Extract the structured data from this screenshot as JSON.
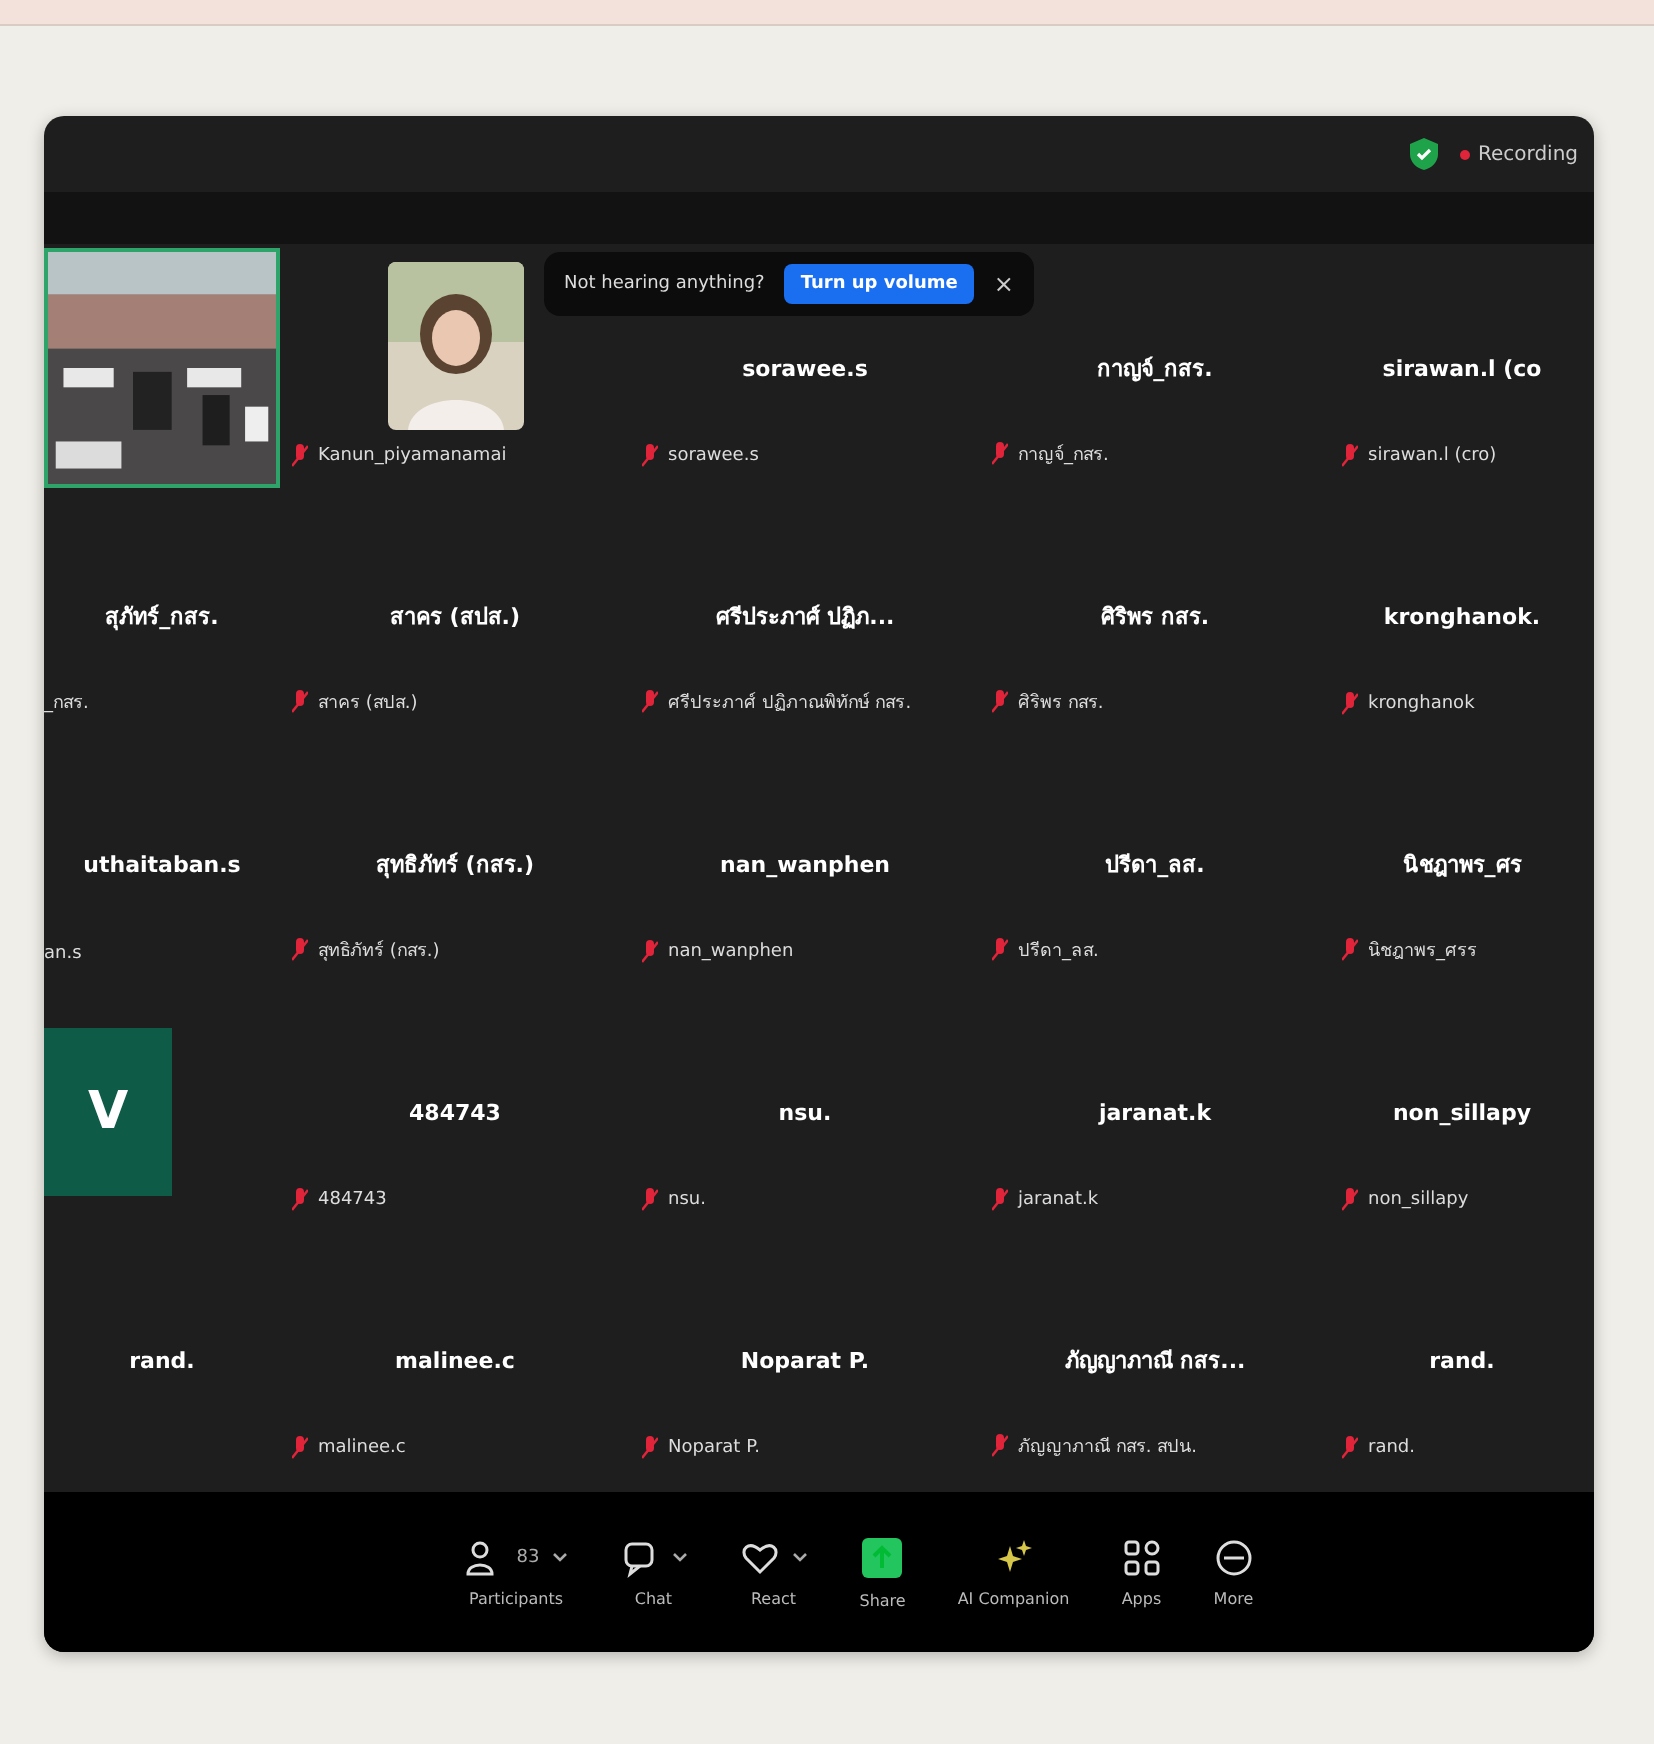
{
  "top_bar": {
    "recording": "Recording"
  },
  "toast": {
    "message": "Not hearing anything?",
    "button": "Turn up volume",
    "close": "×"
  },
  "tiles": [
    {
      "kind": "video"
    },
    {
      "label": "Kanun_piyamanamai",
      "muted": true
    },
    {
      "kind": "name",
      "name": "sorawee.s",
      "label": "sorawee.s",
      "muted": true
    },
    {
      "kind": "name",
      "name": "กาญจ์_กสร.",
      "label": "กาญจ์_กสร.",
      "muted": true
    },
    {
      "kind": "name",
      "name": "sirawan.l (co",
      "label": "sirawan.l (cro)",
      "muted": true
    },
    {
      "kind": "name",
      "name": "สุภัทร์_กสร.",
      "label": "_กสร."
    },
    {
      "kind": "name",
      "name": "สาคร (สปส.)",
      "label": "สาคร (สปส.)",
      "muted": true
    },
    {
      "kind": "name",
      "name": "ศรีประภาศ์ ปฏิภ...",
      "label": "ศรีประภาศ์ ปฏิภาณพิทักษ์ กสร.",
      "muted": true
    },
    {
      "kind": "name",
      "name": "ศิริพร กสร.",
      "label": "ศิริพร กสร.",
      "muted": true
    },
    {
      "kind": "name",
      "name": "kronghanok.",
      "label": "kronghanok",
      "muted": true
    },
    {
      "kind": "name",
      "name": "uthaitaban.s",
      "label": "an.s"
    },
    {
      "kind": "name",
      "name": "สุทธิภัทร์ (กสร.)",
      "label": "สุทธิภัทร์ (กสร.)",
      "muted": true
    },
    {
      "kind": "name",
      "name": "nan_wanphen",
      "label": "nan_wanphen",
      "muted": true
    },
    {
      "kind": "name",
      "name": "ปรีดา_ลส.",
      "label": "ปรีดา_ลส.",
      "muted": true
    },
    {
      "kind": "name",
      "name": "นิชฎาพร_ศร",
      "label": "นิชฎาพร_ศรร",
      "muted": true
    },
    {
      "kind": "avatar",
      "name": "V"
    },
    {
      "kind": "name",
      "name": "484743",
      "label": "484743",
      "muted": true
    },
    {
      "kind": "name",
      "name": "nsu.",
      "label": "nsu.",
      "muted": true
    },
    {
      "kind": "name",
      "name": "jaranat.k",
      "label": "jaranat.k",
      "muted": true
    },
    {
      "kind": "name",
      "name": "non_sillapy",
      "label": "non_sillapy",
      "muted": true
    },
    {
      "kind": "name",
      "name": "rand."
    },
    {
      "kind": "name",
      "name": "malinee.c",
      "label": "malinee.c",
      "muted": true
    },
    {
      "kind": "name",
      "name": "Noparat P.",
      "label": "Noparat P.",
      "muted": true
    },
    {
      "kind": "name",
      "name": "ภัญญาภาณี กสร...",
      "label": "ภัญญาภาณี กสร. สปน.",
      "muted": true
    },
    {
      "kind": "name",
      "name": "rand.",
      "label": "rand.",
      "muted": true
    }
  ],
  "toolbar": [
    {
      "kind": "participants",
      "label": "Participants",
      "count": "83",
      "caret": true
    },
    {
      "kind": "chat",
      "label": "Chat",
      "caret": true
    },
    {
      "kind": "react",
      "label": "React",
      "caret": true
    },
    {
      "kind": "share",
      "label": "Share"
    },
    {
      "kind": "ai",
      "label": "AI Companion"
    },
    {
      "kind": "apps",
      "label": "Apps"
    },
    {
      "kind": "more",
      "label": "More"
    }
  ]
}
